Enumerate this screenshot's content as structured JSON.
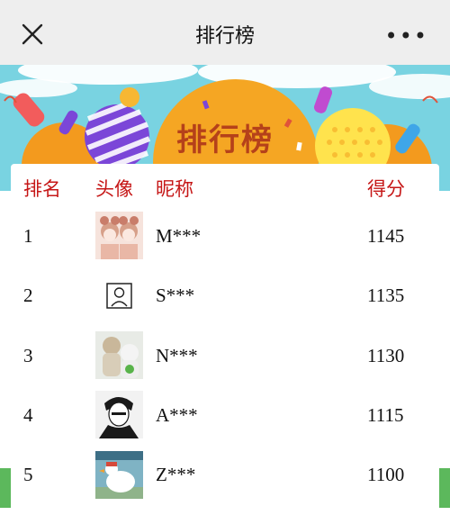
{
  "topbar": {
    "title": "排行榜",
    "close_icon": "close-icon",
    "more_label": "•••"
  },
  "banner": {
    "title": "排行榜",
    "colors": {
      "sky": "#79d3e1",
      "orange": "#f5a623",
      "title_text": "#b5411a"
    }
  },
  "table": {
    "headers": {
      "rank": "排名",
      "avatar": "头像",
      "nickname": "昵称",
      "score": "得分"
    },
    "header_color": "#c61717",
    "rows": [
      {
        "rank": "1",
        "name": "M***",
        "score": "1145"
      },
      {
        "rank": "2",
        "name": "S***",
        "score": "1135"
      },
      {
        "rank": "3",
        "name": "N***",
        "score": "1130"
      },
      {
        "rank": "4",
        "name": "A***",
        "score": "1115"
      },
      {
        "rank": "5",
        "name": "Z***",
        "score": "1100"
      }
    ]
  }
}
